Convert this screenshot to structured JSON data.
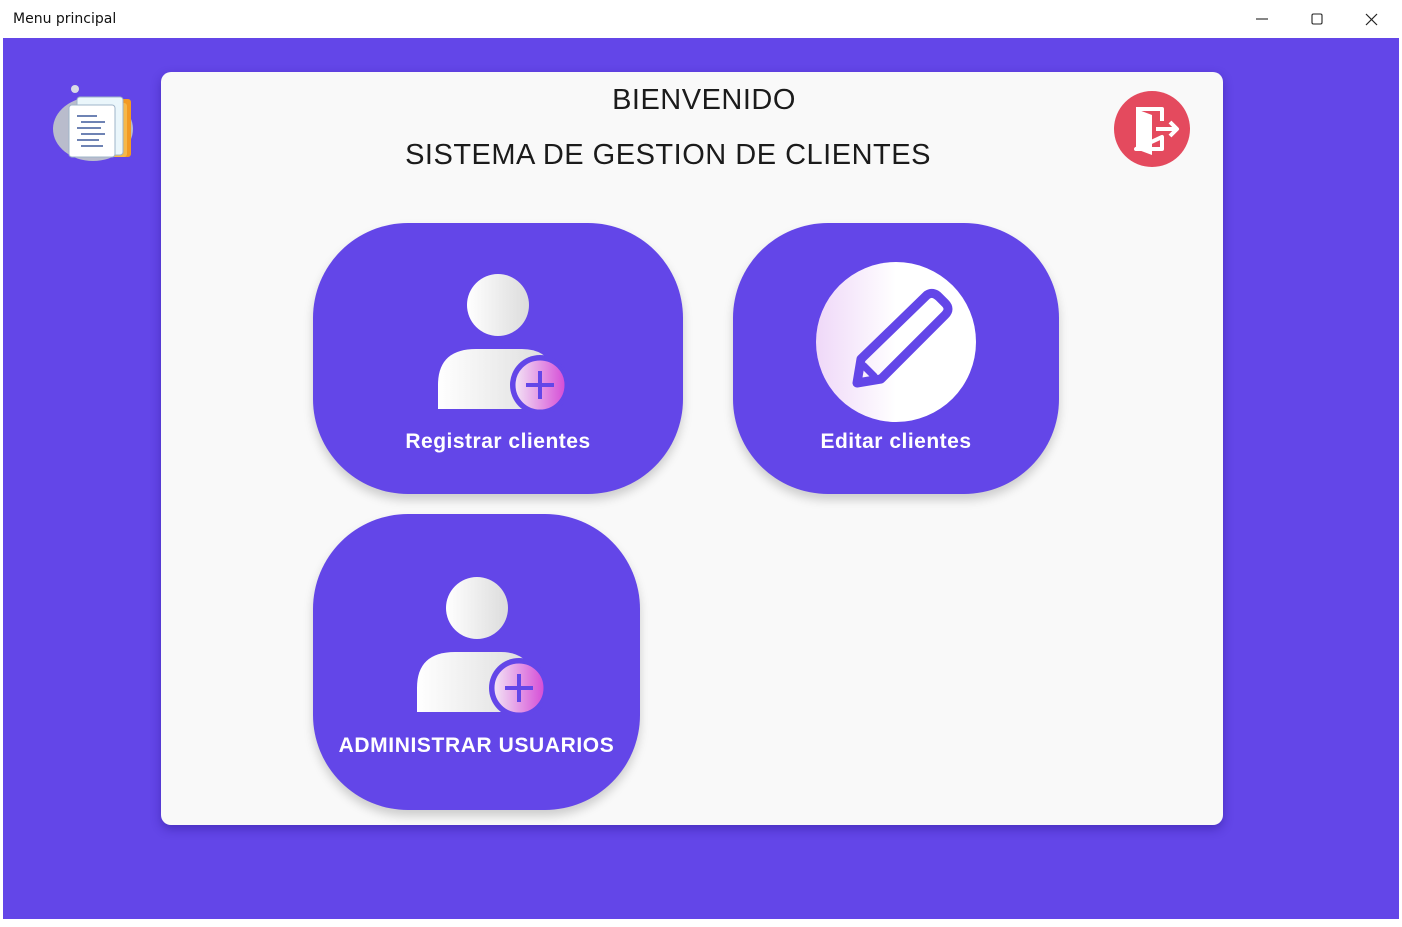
{
  "window": {
    "title": "Menu principal",
    "minimize_glyph": "—",
    "maximize_glyph": "☐",
    "close_glyph": "✕"
  },
  "header": {
    "welcome": "BIENVENIDO",
    "subtitle": "SISTEMA DE GESTION DE CLIENTES"
  },
  "actions": {
    "register_label": "Registrar clientes",
    "edit_label": "Editar clientes",
    "admin_label": "ADMINISTRAR USUARIOS"
  },
  "icons": {
    "logo": "document-stack-icon",
    "exit": "exit-door-icon",
    "register": "add-user-icon",
    "edit": "pencil-icon",
    "admin": "add-user-icon"
  },
  "colors": {
    "background": "#6346e8",
    "panel": "#f9f9f9",
    "exit_button": "#e44a5e",
    "text_dark": "#1b1b1b",
    "button_text": "#ffffff"
  }
}
